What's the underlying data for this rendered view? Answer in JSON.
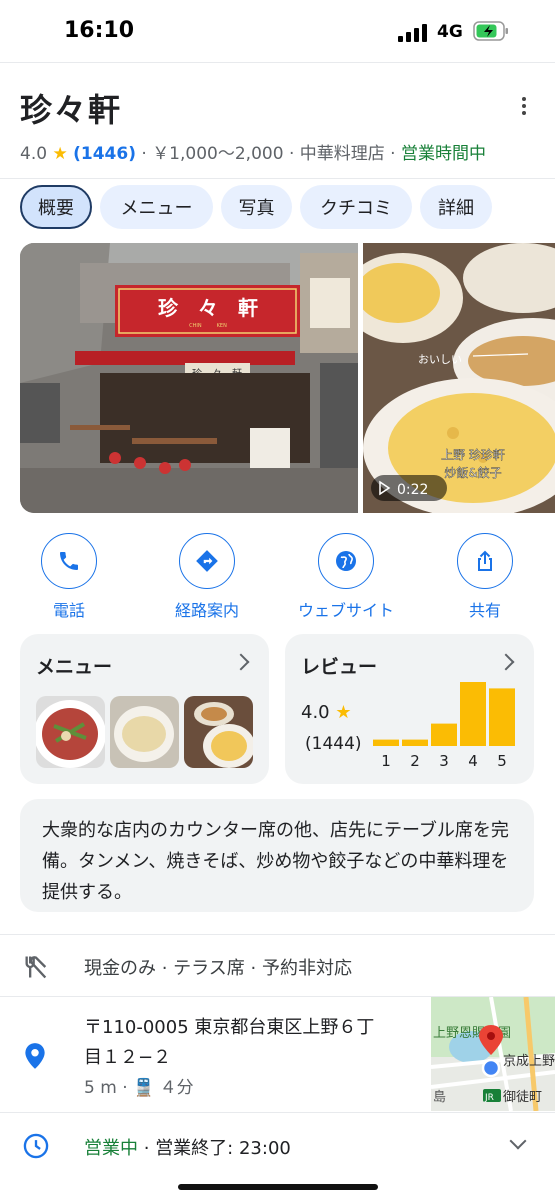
{
  "status": {
    "time": "16:10",
    "network": "4G"
  },
  "place": {
    "name": "珍々軒",
    "rating": "4.0",
    "star": "★",
    "review_count": "(1446)",
    "price": "￥1,000〜2,000",
    "category": "中華料理店",
    "open_status": "営業時間中"
  },
  "tabs": [
    "概要",
    "メニュー",
    "写真",
    "クチコミ",
    "詳細"
  ],
  "photos": {
    "sign_text": "珍　々　軒",
    "sign_sub": "CHIN　　　KEN",
    "small_sign": "珍　々　軒",
    "video_duration": "0:22",
    "video_caption_1": "上野 珍珍軒",
    "video_caption_2": "炒飯&餃子",
    "video_scribble": "おいしい"
  },
  "actions": [
    "電話",
    "経路案内",
    "ウェブサイト",
    "共有"
  ],
  "menu_card": {
    "title": "メニュー"
  },
  "review_card": {
    "title": "レビュー",
    "rating": "4.0",
    "star": "★",
    "count": "(1444)"
  },
  "chart_data": {
    "type": "bar",
    "categories": [
      "1",
      "2",
      "3",
      "4",
      "5"
    ],
    "values": [
      0.1,
      0.1,
      0.35,
      1.0,
      0.9
    ],
    "color": "#fbbc04"
  },
  "description": "大衆的な店内のカウンター席の他、店先にテーブル席を完備。タンメン、焼きそば、炒め物や餃子などの中華料理を提供する。",
  "amenities": "現金のみ · テラス席 · 予約非対応",
  "address": {
    "line1": "〒110-0005 東京都台東区上野６丁",
    "line2": "目１２−２",
    "distance": "5 m",
    "transit": "４分",
    "map_text_1": "上野恩賜公園",
    "map_text_2": "京成上野",
    "map_text_3": "島",
    "map_text_4": "御徒町",
    "map_jr": "JR"
  },
  "hours": {
    "status": "営業中",
    "closing": "営業終了: 23:00"
  },
  "colors": {
    "accent": "#1a73e8",
    "star": "#fbbc04",
    "open": "#188038"
  }
}
